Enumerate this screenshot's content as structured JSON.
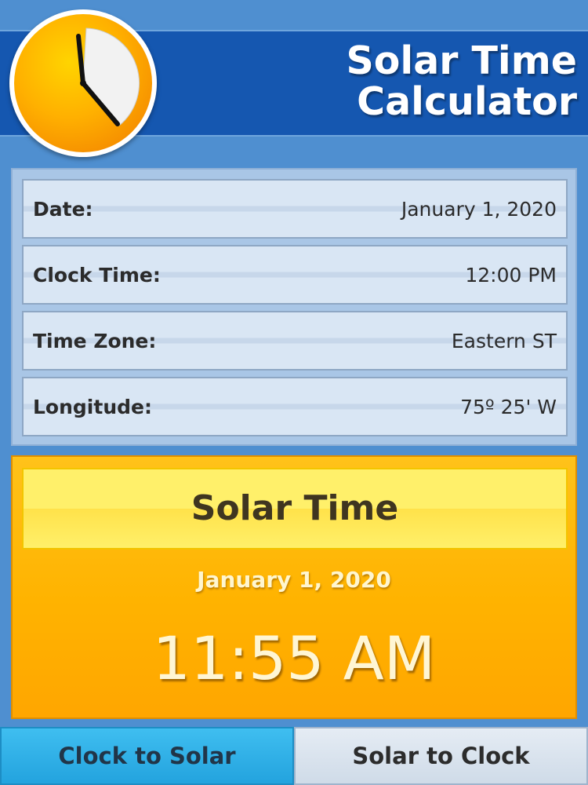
{
  "header": {
    "title": "Solar Time\nCalculator",
    "logo_icon": "clock-icon"
  },
  "inputs": [
    {
      "label": "Date:",
      "value": "January 1, 2020"
    },
    {
      "label": "Clock Time:",
      "value": "12:00 PM"
    },
    {
      "label": "Time Zone:",
      "value": "Eastern ST"
    },
    {
      "label": "Longitude:",
      "value": "75º 25' W"
    }
  ],
  "result": {
    "heading": "Solar Time",
    "date": "January 1, 2020",
    "time": "11:55 AM"
  },
  "modes": {
    "clock_to_solar": "Clock to Solar",
    "solar_to_clock": "Solar to Clock",
    "active": "clock_to_solar"
  },
  "colors": {
    "header_band": "#1557b0",
    "background": "#4f8fd0",
    "result_panel": "#ffb300",
    "active_tab": "#2fb0e6"
  }
}
